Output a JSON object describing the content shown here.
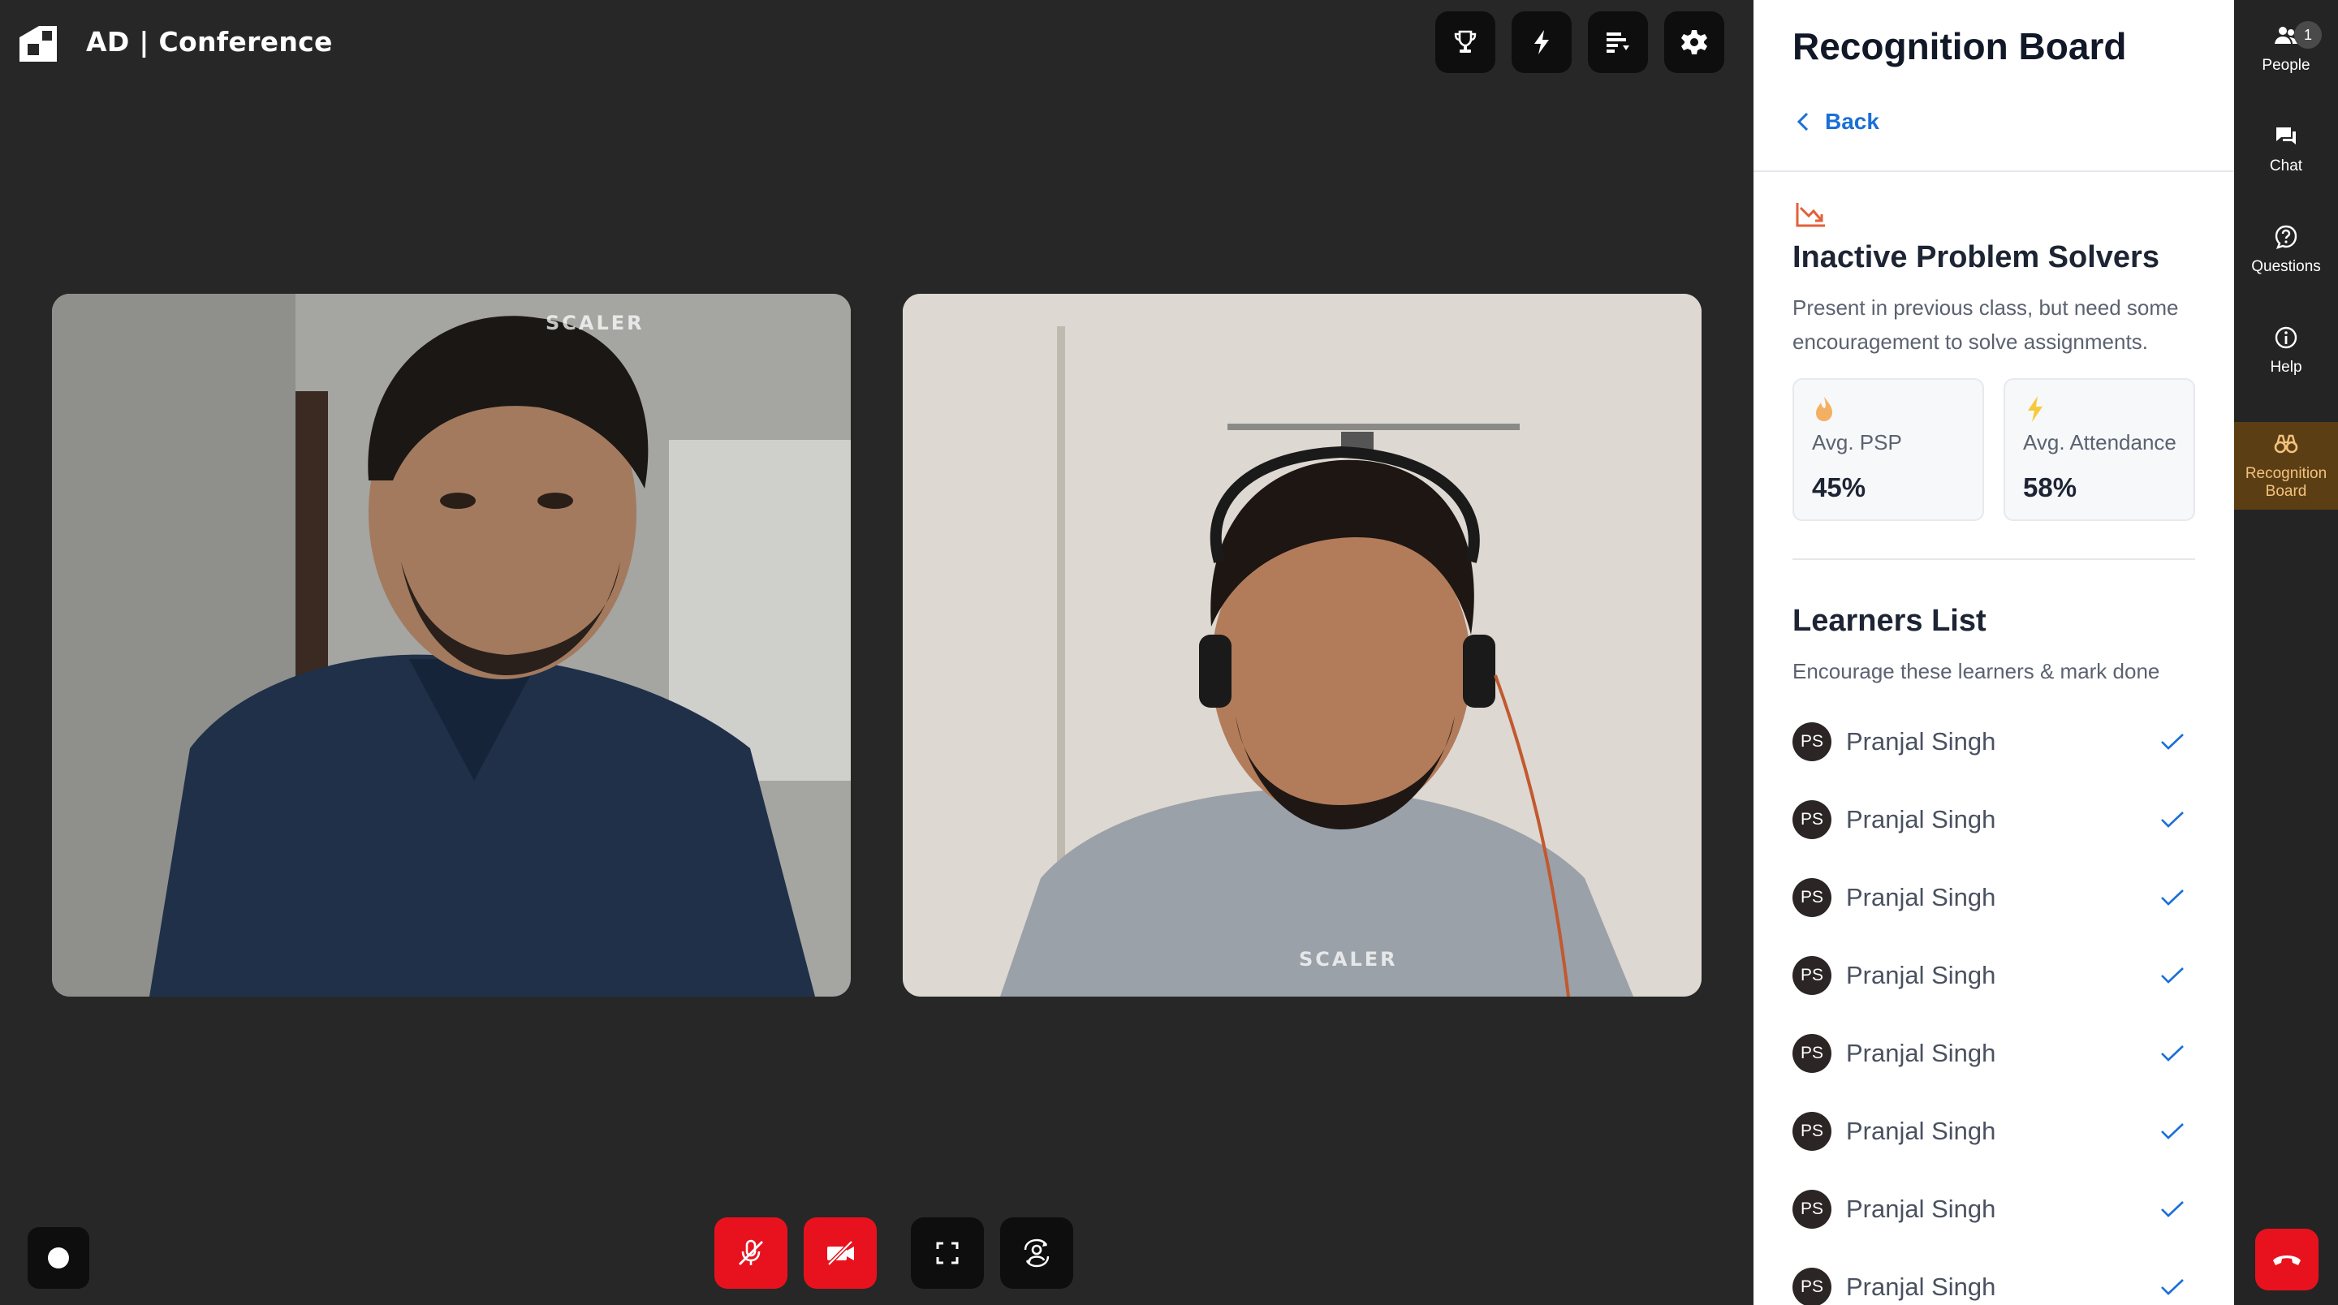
{
  "header": {
    "app_title": "AD | Conference",
    "tools": [
      {
        "name": "trophy-icon"
      },
      {
        "name": "lightning-icon"
      },
      {
        "name": "leaderboard-icon"
      },
      {
        "name": "gear-icon"
      }
    ]
  },
  "videos": [
    {
      "watermark": "SCALER"
    },
    {
      "watermark": "SCALER"
    }
  ],
  "controls": {
    "record": "record-icon",
    "mic": "mic-off-icon",
    "camera": "camera-off-icon",
    "fullscreen": "fullscreen-icon",
    "switch": "switch-camera-icon"
  },
  "panel": {
    "title": "Recognition Board",
    "back_label": "Back",
    "section_title": "Inactive Problem Solvers",
    "section_desc": "Present in previous class, but need some encouragement to solve assignments.",
    "stats": [
      {
        "label": "Avg. PSP",
        "value": "45%",
        "icon": "fire-icon"
      },
      {
        "label": "Avg. Attendance",
        "value": "58%",
        "icon": "lightning-icon"
      }
    ],
    "learners_title": "Learners List",
    "learners_desc": "Encourage these learners & mark done",
    "learners": [
      {
        "initials": "PS",
        "name": "Pranjal Singh"
      },
      {
        "initials": "PS",
        "name": "Pranjal Singh"
      },
      {
        "initials": "PS",
        "name": "Pranjal Singh"
      },
      {
        "initials": "PS",
        "name": "Pranjal Singh"
      },
      {
        "initials": "PS",
        "name": "Pranjal Singh"
      },
      {
        "initials": "PS",
        "name": "Pranjal Singh"
      },
      {
        "initials": "PS",
        "name": "Pranjal Singh"
      },
      {
        "initials": "PS",
        "name": "Pranjal Singh"
      }
    ]
  },
  "rail": {
    "people_label": "People",
    "people_count": "1",
    "chat_label": "Chat",
    "questions_label": "Questions",
    "help_label": "Help",
    "recognition_label_1": "Recognition",
    "recognition_label_2": "Board"
  },
  "colors": {
    "background": "#272727",
    "accent_red": "#e8121e",
    "link_blue": "#1a6fd8",
    "active_rail": "#5c3e14"
  }
}
